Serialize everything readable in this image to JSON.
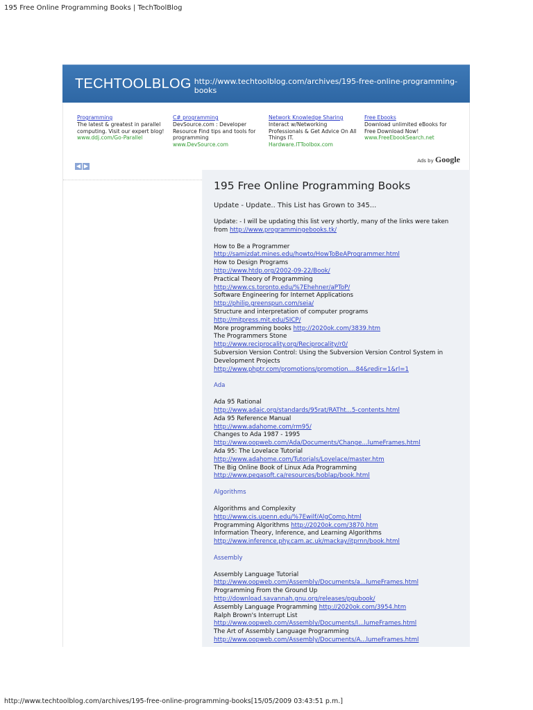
{
  "page": {
    "header": "195 Free Online Programming Books | TechToolBlog",
    "footer": "http://www.techtoolblog.com/archives/195-free-online-programming-books[15/05/2009 03:43:51 p.m.]"
  },
  "banner": {
    "title": "TECHTOOLBLOG",
    "url": "http://www.techtoolblog.com/archives/195-free-online-programming-books"
  },
  "ads": [
    {
      "title": "Programming",
      "text": "The latest & greatest in parallel computing. Visit our expert blog!",
      "url": "www.ddj.com/Go-Parallel"
    },
    {
      "title": "C# programming",
      "text": "DevSource.com : Developer Resource Find tips and tools for programming",
      "url": "www.DevSource.com"
    },
    {
      "title": "Network Knowledge Sharing",
      "text": "Interact w/Networking Professionals & Get Advice On All Things IT.",
      "url": "Hardware.ITToolbox.com"
    },
    {
      "title": "Free Ebooks",
      "text": "Download unlimited eBooks for Free Download Now!",
      "url": "www.FreeEbookSearch.net"
    }
  ],
  "ads_by": {
    "label": "Ads by",
    "brand": "Google"
  },
  "post": {
    "title": "195 Free Online Programming Books",
    "lead": "Update - Update.. This List has Grown to 345...",
    "update_text": "Update: - I will be updating this list very shortly, many of the links were taken from",
    "update_link": "http://www.programmingebooks.tk/",
    "items1": [
      {
        "label": "How to Be a Programmer",
        "link": "http://samizdat.mines.edu/howto/HowToBeAProgrammer.html"
      },
      {
        "label": "How to Design Programs",
        "link": "http://www.htdp.org/2002-09-22/Book/"
      },
      {
        "label": "Practical Theory of Programming",
        "link": "http://www.cs.toronto.edu/%7Ehehner/aPToP/"
      },
      {
        "label": "Software Engineering for Internet Applications",
        "link": "http://philip.greenspun.com/seia/"
      },
      {
        "label": "Structure and interpretation of computer programs",
        "link": "http://mitpress.mit.edu/SICP/"
      }
    ],
    "more_books": {
      "label": "More programming books",
      "link": "http://2020ok.com/3839.htm"
    },
    "items2": [
      {
        "label": "The Programmers Stone",
        "link": "http://www.reciprocality.org/Reciprocality/r0/"
      },
      {
        "label": "Subversion Version Control: Using the Subversion Version Control System in Development Projects",
        "link": "http://www.phptr.com/promotions/promotion....84&redir=1&rl=1"
      }
    ],
    "ada": {
      "heading": "Ada",
      "items": [
        {
          "label": "Ada 95 Rational",
          "link": "http://www.adaic.org/standards/95rat/RATht...5-contents.html"
        },
        {
          "label": "Ada 95 Reference Manual",
          "link": "http://www.adahome.com/rm95/"
        },
        {
          "label": "Changes to Ada 1987 - 1995",
          "link": "http://www.oopweb.com/Ada/Documents/Change...lumeFrames.html"
        },
        {
          "label": "Ada 95: The Lovelace Tutorial",
          "link": "http://www.adahome.com/Tutorials/Lovelace/master.htm"
        },
        {
          "label": "The Big Online Book of Linux Ada Programming",
          "link": "http://www.pegasoft.ca/resources/boblap/book.html"
        }
      ]
    },
    "algorithms": {
      "heading": "Algorithms",
      "i1": {
        "label": "Algorithms and Complexity",
        "link": "http://www.cis.upenn.edu/%7Ewilf/AlgComp.html"
      },
      "i2": {
        "label": "Programming Algorithms",
        "link": "http://2020ok.com/3870.htm"
      },
      "i3": {
        "label": "Information Theory, Inference, and Learning Algorithms",
        "link": "http://www.inference.phy.cam.ac.uk/mackay/itprnn/book.html"
      }
    },
    "assembly": {
      "heading": "Assembly",
      "i1": {
        "label": "Assembly Language Tutorial",
        "link": "http://www.oopweb.com/Assembly/Documents/a...lumeFrames.html"
      },
      "i2": {
        "label": "Programming From the Ground Up",
        "link": "http://download.savannah.gnu.org/releases/pgubook/"
      },
      "i3": {
        "label": "Assembly Language Programming",
        "link": "http://2020ok.com/3954.htm"
      },
      "i4": {
        "label": "Ralph Brown's Interrupt List",
        "link": "http://www.oopweb.com/Assembly/Documents/I...lumeFrames.html"
      },
      "i5": {
        "label": "The Art of Assembly Language Programming",
        "link": "http://www.oopweb.com/Assembly/Documents/A...lumeFrames.html"
      }
    }
  },
  "colors": {
    "banner": "#3d78b6",
    "link": "#2b3fc8",
    "ad_url": "#2f9a2f",
    "content_bg": "#eef1f5"
  }
}
